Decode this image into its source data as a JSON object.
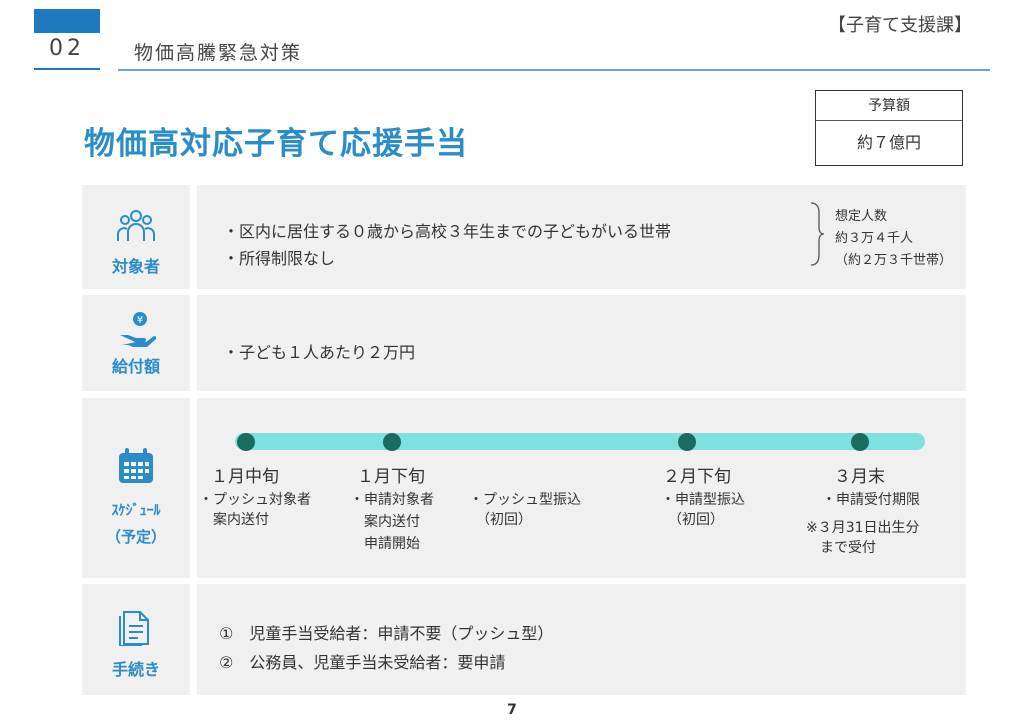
{
  "header": {
    "section_number": "02",
    "section_title": "物価高騰緊急対策",
    "department": "【子育て支援課】"
  },
  "budget": {
    "label": "予算額",
    "value": "約７億円"
  },
  "title": "物価高対応子育て応援手当",
  "rows": {
    "target": {
      "label": "対象者",
      "icon": "people-icon",
      "lines": [
        "・区内に居住する０歳から高校３年生までの子どもがいる世帯",
        "・所得制限なし"
      ],
      "note": [
        "想定人数",
        "約３万４千人",
        "（約２万３千世帯）"
      ]
    },
    "amount": {
      "label": "給付額",
      "icon": "hand-coin-icon",
      "lines": [
        "・子ども１人あたり２万円"
      ]
    },
    "schedule": {
      "label_line1": "ｽｹｼﾞｭｰﾙ",
      "label_line2": "（予定）",
      "icon": "calendar-icon",
      "milestones": [
        {
          "date": "１月中旬",
          "lines": [
            "・プッシュ対象者",
            "　案内送付"
          ]
        },
        {
          "date": "１月下旬",
          "lines": [
            "・申請対象者",
            "　案内送付",
            "　申請開始"
          ]
        },
        {
          "date": "",
          "lines": [
            "・プッシュ型振込",
            "　（初回）"
          ]
        },
        {
          "date": "２月下旬",
          "lines": [
            "・申請型振込",
            "　（初回）"
          ]
        },
        {
          "date": "３月末",
          "lines": [
            "・申請受付期限",
            "※３月31日出生分",
            "　まで受付"
          ]
        }
      ]
    },
    "procedure": {
      "label": "手続き",
      "icon": "document-icon",
      "lines": [
        "①　児童手当受給者：申請不要（プッシュ型）",
        "②　公務員、児童手当未受給者：要申請"
      ]
    }
  },
  "page_number": "7",
  "colors": {
    "accent_blue": "#2a8cc8",
    "header_blue": "#1f79bf",
    "timeline": "#7fe0e0",
    "timeline_dot": "#1b6b61",
    "row_bg": "#f0f0f0"
  }
}
